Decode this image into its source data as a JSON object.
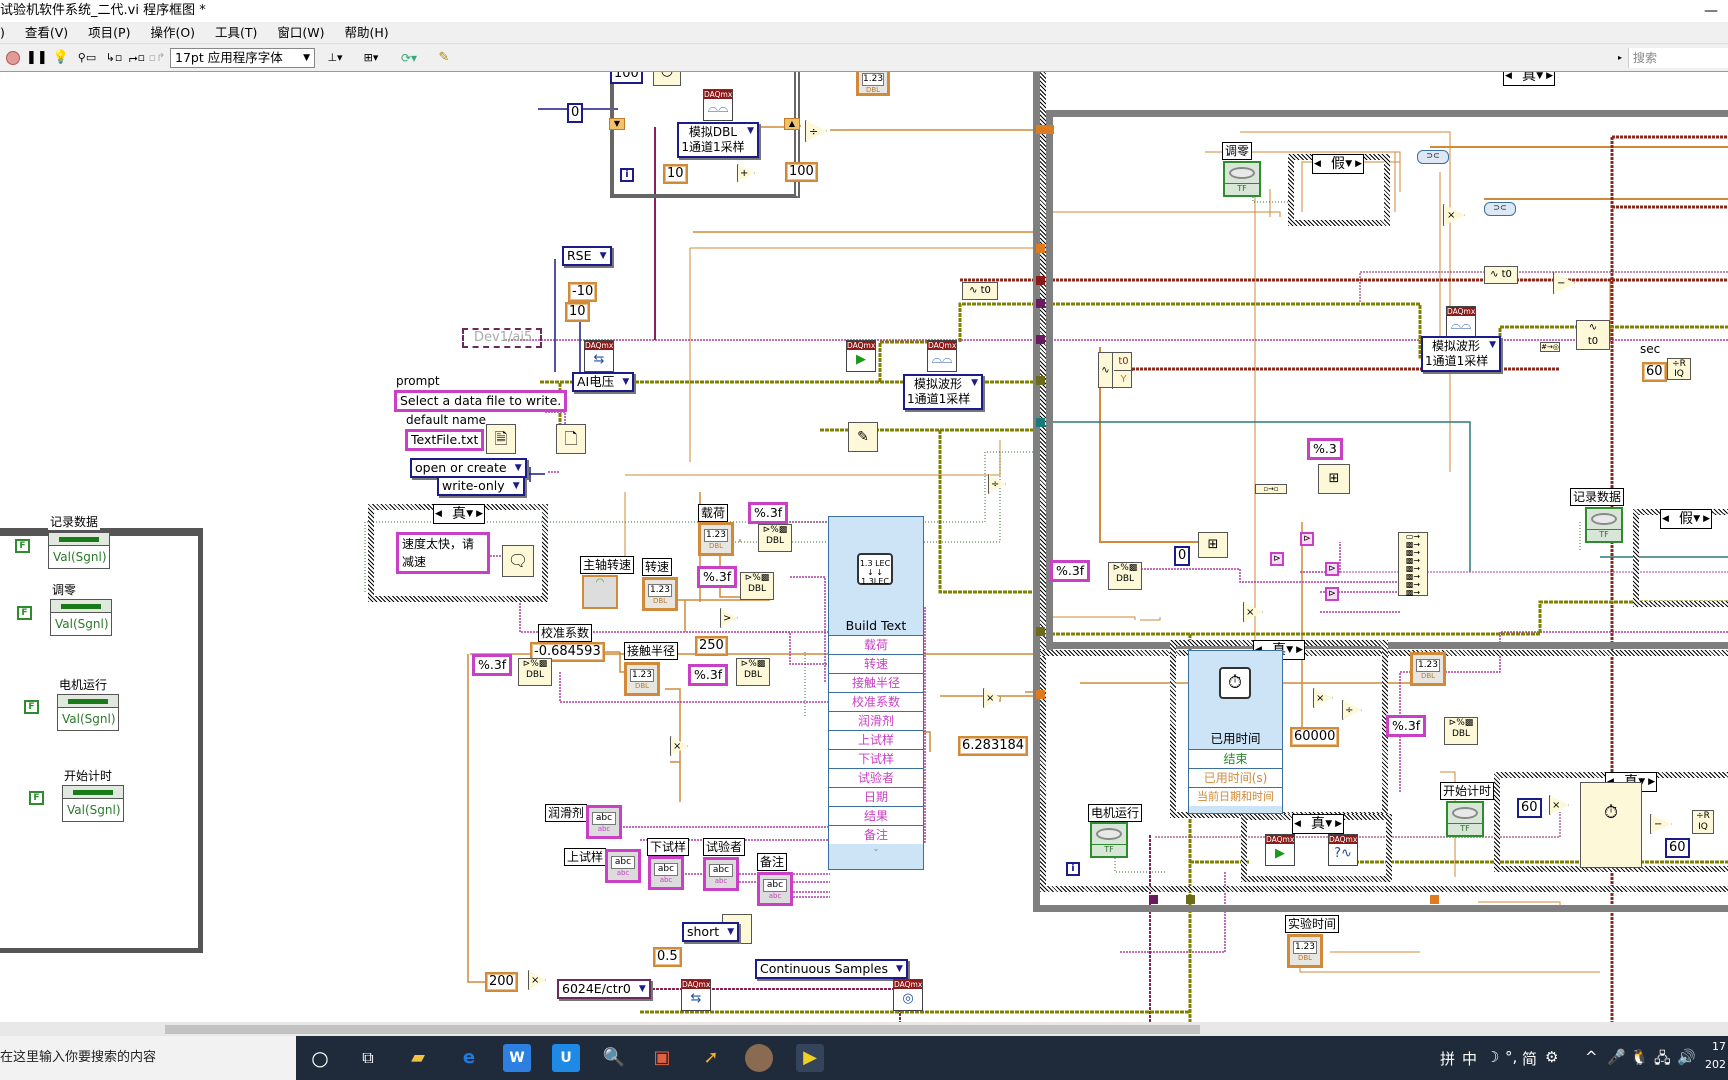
{
  "window": {
    "title": "试验机软件系统_二代.vi 程序框图 *",
    "minimize_glyph": "—"
  },
  "menu": {
    "items": [
      ")",
      "查看(V)",
      "项目(P)",
      "操作(O)",
      "工具(T)",
      "窗口(W)",
      "帮助(H)"
    ]
  },
  "toolbar": {
    "font_selector": "17pt 应用程序字体",
    "search_placeholder": "搜索",
    "icons": [
      "abort-icon",
      "pause-icon",
      "highlight-execution-icon",
      "retain-wire-values-icon",
      "step-into-icon",
      "step-over-icon",
      "step-out-icon",
      "align-icon",
      "distribute-icon",
      "reorder-icon",
      "cleanup-icon"
    ]
  },
  "diagram": {
    "constants": {
      "loop_wait_ms": "100",
      "shift_init": "0",
      "avg_count": "10",
      "divisor_100": "100",
      "terminal_config": "RSE",
      "min_val": "-10",
      "max_val": "10",
      "channel": "Dev1/ai5",
      "ai_voltage": "AI电压",
      "prompt_label": "prompt",
      "prompt_value": "Select a data file to write.",
      "default_name_label": "default name",
      "default_name_value": "TextFile.txt",
      "open_mode": "open or create",
      "access_mode": "write-only",
      "case_true": "真",
      "case_false": "假",
      "warning_msg": "速度太快，请减速",
      "read_dbl": "模拟DBL\n1通道1采样",
      "read_wfm": "模拟波形\n1通道1采样",
      "read_wfm2": "模拟波形\n1通道1采样",
      "fmt_3f": "%.3f",
      "fmt_3": "%.3",
      "calib_value": "-0.684593",
      "threshold": "250",
      "two_pi": "6.283184",
      "ms_per_min": "60000",
      "date_format": "short",
      "counter_channel": "6024E/ctr0",
      "duty": "0.5",
      "sample_mode": "Continuous Samples",
      "const_200": "200",
      "const_60": "60",
      "const_0": "0",
      "sec_label": "sec",
      "t0": "t0",
      "y": "Y"
    },
    "labels": {
      "load": "载荷",
      "speed": "转速",
      "spindle_speed": "主轴转速",
      "calib_coeff": "校准系数",
      "contact_radius": "接触半径",
      "lubricant": "润滑剂",
      "upper_sample": "上试样",
      "lower_sample": "下试样",
      "tester": "试验者",
      "remark": "备注",
      "zero": "调零",
      "record_data": "记录数据",
      "motor_run": "电机运行",
      "start_timer": "开始计时",
      "exp_time": "实验时间"
    },
    "build_text": {
      "title": "Build Text",
      "inputs": [
        "载荷",
        "转速",
        "接触半径",
        "校准系数",
        "润滑剂",
        "上试样",
        "下试样",
        "试验者",
        "日期",
        "结果",
        "备注"
      ]
    },
    "elapsed_time": {
      "title": "已用时间",
      "outputs": [
        "结束",
        "已用时间(s)",
        "当前日期和时间"
      ]
    },
    "property_nodes": [
      {
        "label": "记录数据",
        "property": "Val(Sgnl)",
        "value": "F"
      },
      {
        "label": "调零",
        "property": "Val(Sgnl)",
        "value": "F"
      },
      {
        "label": "电机运行",
        "property": "Val(Sgnl)",
        "value": "F"
      },
      {
        "label": "开始计时",
        "property": "Val(Sgnl)",
        "value": "F"
      }
    ],
    "indicators": {
      "dbl": "1.23",
      "dbl_type": "DBL",
      "abc": "abc",
      "tf": "TF",
      "iter": "i"
    }
  },
  "taskbar": {
    "search_text": "在这里输入你要搜索的内容",
    "tray": [
      "拼",
      "中",
      "☽",
      "°,",
      "简",
      "⚙",
      "^",
      "🎤",
      "🐧",
      "🖧",
      "🔊"
    ],
    "clock_top": "17",
    "clock_bottom": "202"
  }
}
